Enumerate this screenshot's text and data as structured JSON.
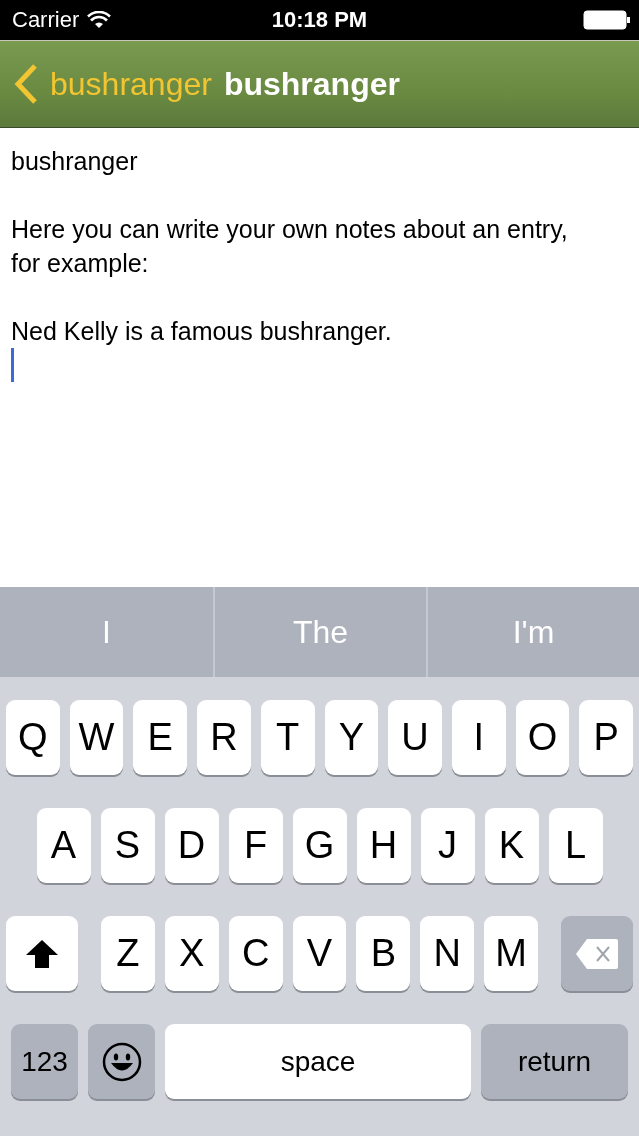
{
  "status_bar": {
    "carrier": "Carrier",
    "time": "10:18 PM"
  },
  "nav_bar": {
    "back_label": "bushranger",
    "title": "bushranger"
  },
  "note": {
    "paragraphs": [
      "bushranger",
      "Here you can write your own notes about an entry, for example:",
      "Ned Kelly is a famous bushranger."
    ]
  },
  "suggestions": [
    "I",
    "The",
    "I'm"
  ],
  "keyboard": {
    "rows": [
      [
        {
          "kind": "letter",
          "label": "Q"
        },
        {
          "kind": "letter",
          "label": "W"
        },
        {
          "kind": "letter",
          "label": "E"
        },
        {
          "kind": "letter",
          "label": "R"
        },
        {
          "kind": "letter",
          "label": "T"
        },
        {
          "kind": "letter",
          "label": "Y"
        },
        {
          "kind": "letter",
          "label": "U"
        },
        {
          "kind": "letter",
          "label": "I"
        },
        {
          "kind": "letter",
          "label": "O"
        },
        {
          "kind": "letter",
          "label": "P"
        }
      ],
      [
        {
          "kind": "letter",
          "label": "A"
        },
        {
          "kind": "letter",
          "label": "S"
        },
        {
          "kind": "letter",
          "label": "D"
        },
        {
          "kind": "letter",
          "label": "F"
        },
        {
          "kind": "letter",
          "label": "G"
        },
        {
          "kind": "letter",
          "label": "H"
        },
        {
          "kind": "letter",
          "label": "J"
        },
        {
          "kind": "letter",
          "label": "K"
        },
        {
          "kind": "letter",
          "label": "L"
        }
      ],
      [
        {
          "kind": "shift"
        },
        {
          "kind": "letter",
          "label": "Z"
        },
        {
          "kind": "letter",
          "label": "X"
        },
        {
          "kind": "letter",
          "label": "C"
        },
        {
          "kind": "letter",
          "label": "V"
        },
        {
          "kind": "letter",
          "label": "B"
        },
        {
          "kind": "letter",
          "label": "N"
        },
        {
          "kind": "letter",
          "label": "M"
        },
        {
          "kind": "delete"
        }
      ]
    ],
    "numbers_key": "123",
    "space_key": "space",
    "return_key": "return"
  }
}
